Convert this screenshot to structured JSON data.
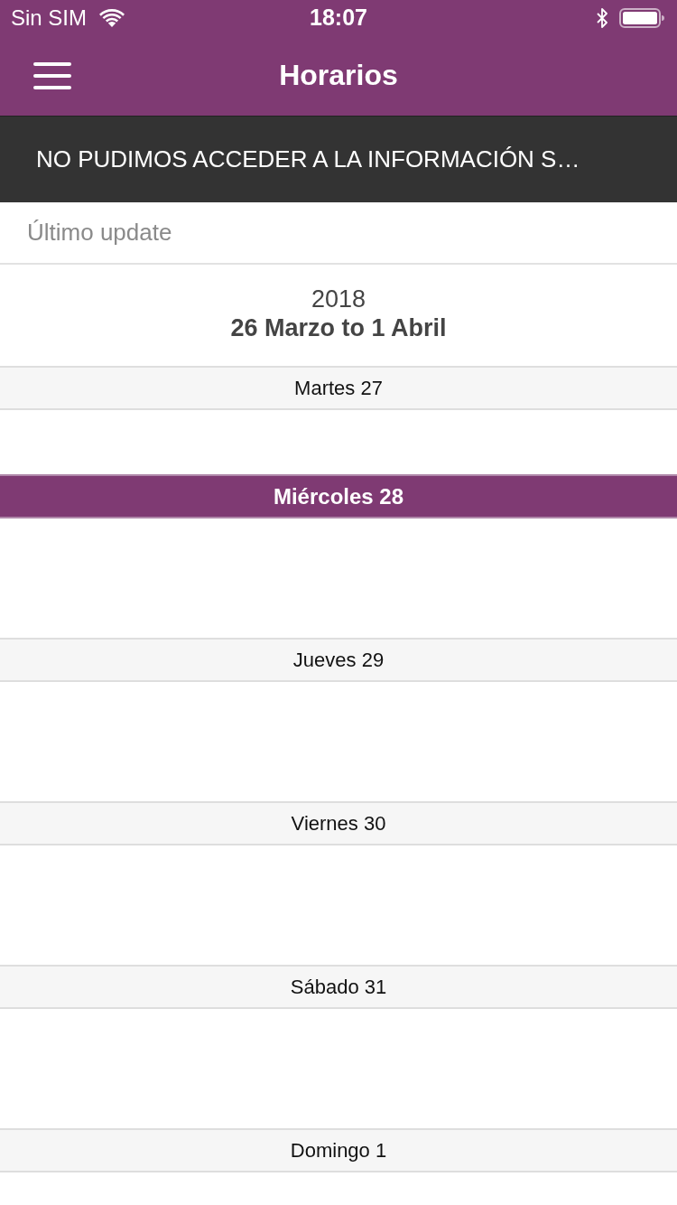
{
  "status_bar": {
    "carrier": "Sin SIM",
    "time": "18:07"
  },
  "nav_bar": {
    "title": "Horarios"
  },
  "error_banner": {
    "text": "NO PUDIMOS ACCEDER A LA INFORMACIÓN S…"
  },
  "last_update": {
    "label": "Último update"
  },
  "week": {
    "year": "2018",
    "range": "26 Marzo to 1 Abril"
  },
  "days": [
    {
      "label": "Martes 27",
      "selected": false
    },
    {
      "label": "Miércoles 28",
      "selected": true
    },
    {
      "label": "Jueves 29",
      "selected": false
    },
    {
      "label": "Viernes 30",
      "selected": false
    },
    {
      "label": "Sábado 31",
      "selected": false
    },
    {
      "label": "Domingo 1",
      "selected": false
    }
  ]
}
